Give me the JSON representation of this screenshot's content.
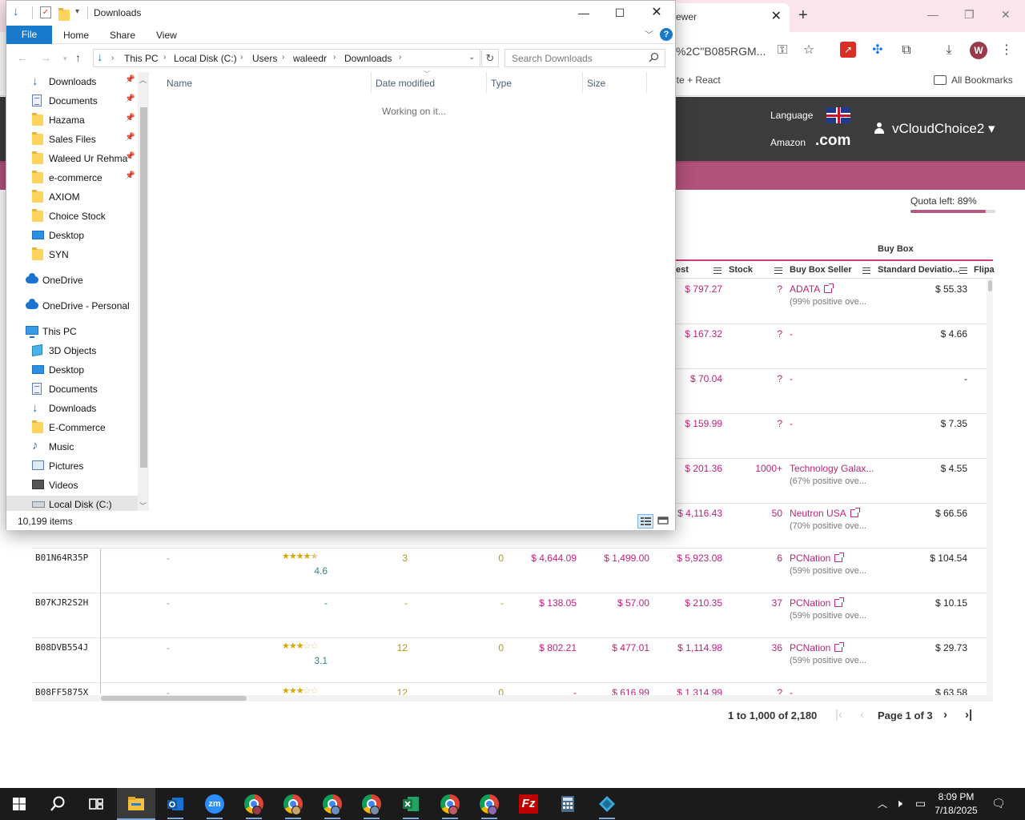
{
  "browser": {
    "tab_title": "ewer",
    "url_fragment": "%2C\"B085RGM...",
    "bookmark_left": "ite + React",
    "all_bookmarks": "All Bookmarks",
    "avatar_letter": "W"
  },
  "keepa": {
    "language_label": "Language",
    "amazon_label": "Amazon",
    "domain": ".com",
    "username": "vCloudChoice2",
    "quota_text": "Quota left: 89%",
    "quota_fraction": 0.89
  },
  "grid": {
    "group_header": "Buy Box",
    "columns": [
      "est",
      "Stock",
      "Buy Box Seller",
      "Standard Deviatio...",
      "Flipa"
    ],
    "rows": [
      {
        "price": "$ 797.27",
        "stock": "?",
        "seller": "ADATA",
        "seller_sub": "(99% positive ove...",
        "std": "$ 55.33",
        "link": true
      },
      {
        "price": "$ 167.32",
        "stock": "?",
        "seller": "-",
        "seller_sub": "",
        "std": "$ 4.66",
        "link": false
      },
      {
        "price": "$ 70.04",
        "stock": "?",
        "seller": "-",
        "seller_sub": "",
        "std": "-",
        "link": false
      },
      {
        "price": "$ 159.99",
        "stock": "?",
        "seller": "-",
        "seller_sub": "",
        "std": "$ 7.35",
        "link": false
      },
      {
        "price": "$ 201.36",
        "stock": "1000+",
        "seller": "Technology Galax...",
        "seller_sub": "(67% positive ove...",
        "std": "$ 4.55",
        "link": false
      },
      {
        "price": "$ 4,116.43",
        "stock": "50",
        "seller": "Neutron USA",
        "seller_sub": "(70% positive ove...",
        "std": "$ 66.56",
        "link": true
      },
      {
        "asin": "B01N64R35P",
        "dash": "-",
        "rating": "4.6",
        "stars": 4.6,
        "c1": "3",
        "c2": "0",
        "p1": "$ 4,644.09",
        "p2": "$ 1,499.00",
        "price": "$ 5,923.08",
        "stock": "6",
        "seller": "PCNation",
        "seller_sub": "(59% positive ove...",
        "std": "$ 104.54",
        "link": true
      },
      {
        "asin": "B07KJR2S2H",
        "dash": "-",
        "rating": "-",
        "stars": 0,
        "c1": "-",
        "c2": "-",
        "p1": "$ 138.05",
        "p2": "$ 57.00",
        "price": "$ 210.35",
        "stock": "37",
        "seller": "PCNation",
        "seller_sub": "(59% positive ove...",
        "std": "$ 10.15",
        "link": true
      },
      {
        "asin": "B08DVB554J",
        "dash": "-",
        "rating": "3.1",
        "stars": 3.1,
        "c1": "12",
        "c2": "0",
        "p1": "$ 802.21",
        "p2": "$ 477.01",
        "price": "$ 1,114.98",
        "stock": "36",
        "seller": "PCNation",
        "seller_sub": "(59% positive ove...",
        "std": "$ 29.73",
        "link": true
      },
      {
        "asin": "B08FF5875X",
        "dash": "-",
        "rating": "",
        "stars": 3,
        "c1": "12",
        "c2": "0",
        "p1": "-",
        "p2": "$ 616.99",
        "price": "$ 1,314.99",
        "stock": "?",
        "seller": "-",
        "seller_sub": "",
        "std": "$ 63.58",
        "link": false
      }
    ],
    "pager_range": "1 to 1,000 of 2,180",
    "pager_page": "Page 1 of 3"
  },
  "explorer": {
    "title": "Downloads",
    "ribbon": {
      "file": "File",
      "home": "Home",
      "share": "Share",
      "view": "View"
    },
    "breadcrumb": [
      "This PC",
      "Local Disk (C:)",
      "Users",
      "waleedr",
      "Downloads"
    ],
    "search_placeholder": "Search Downloads",
    "nav": [
      {
        "label": "Downloads",
        "icon": "download-arrow-icon",
        "pinned": true
      },
      {
        "label": "Documents",
        "icon": "document-icon",
        "pinned": true
      },
      {
        "label": "Hazama",
        "icon": "folder-icon",
        "pinned": true
      },
      {
        "label": "Sales Files",
        "icon": "folder-icon",
        "pinned": true
      },
      {
        "label": "Waleed Ur Rehma",
        "icon": "folder-icon",
        "pinned": true
      },
      {
        "label": "e-commerce",
        "icon": "folder-icon",
        "pinned": true
      },
      {
        "label": "AXIOM",
        "icon": "folder-icon",
        "pinned": false
      },
      {
        "label": "Choice Stock",
        "icon": "folder-icon",
        "pinned": false
      },
      {
        "label": "Desktop",
        "icon": "desktop-icon",
        "pinned": false
      },
      {
        "label": "SYN",
        "icon": "folder-icon",
        "pinned": false
      },
      {
        "label": "OneDrive",
        "icon": "onedrive-icon",
        "pinned": false
      },
      {
        "label": "OneDrive - Personal",
        "icon": "onedrive-icon",
        "pinned": false
      },
      {
        "label": "This PC",
        "icon": "this-pc-icon",
        "pinned": false
      },
      {
        "label": "3D Objects",
        "icon": "3d-objects-icon",
        "pinned": false
      },
      {
        "label": "Desktop",
        "icon": "desktop-icon",
        "pinned": false
      },
      {
        "label": "Documents",
        "icon": "document-icon",
        "pinned": false
      },
      {
        "label": "Downloads",
        "icon": "download-arrow-icon",
        "pinned": false
      },
      {
        "label": "E-Commerce",
        "icon": "folder-icon",
        "pinned": false
      },
      {
        "label": "Music",
        "icon": "music-icon",
        "pinned": false
      },
      {
        "label": "Pictures",
        "icon": "pictures-icon",
        "pinned": false
      },
      {
        "label": "Videos",
        "icon": "videos-icon",
        "pinned": false
      },
      {
        "label": "Local Disk (C:)",
        "icon": "drive-icon",
        "pinned": false
      }
    ],
    "columns": [
      "Name",
      "Date modified",
      "Type",
      "Size"
    ],
    "status_text": "Working on it...",
    "item_count": "10,199 items"
  },
  "taskbar": {
    "time": "8:09 PM",
    "date": "7/18/2025"
  }
}
